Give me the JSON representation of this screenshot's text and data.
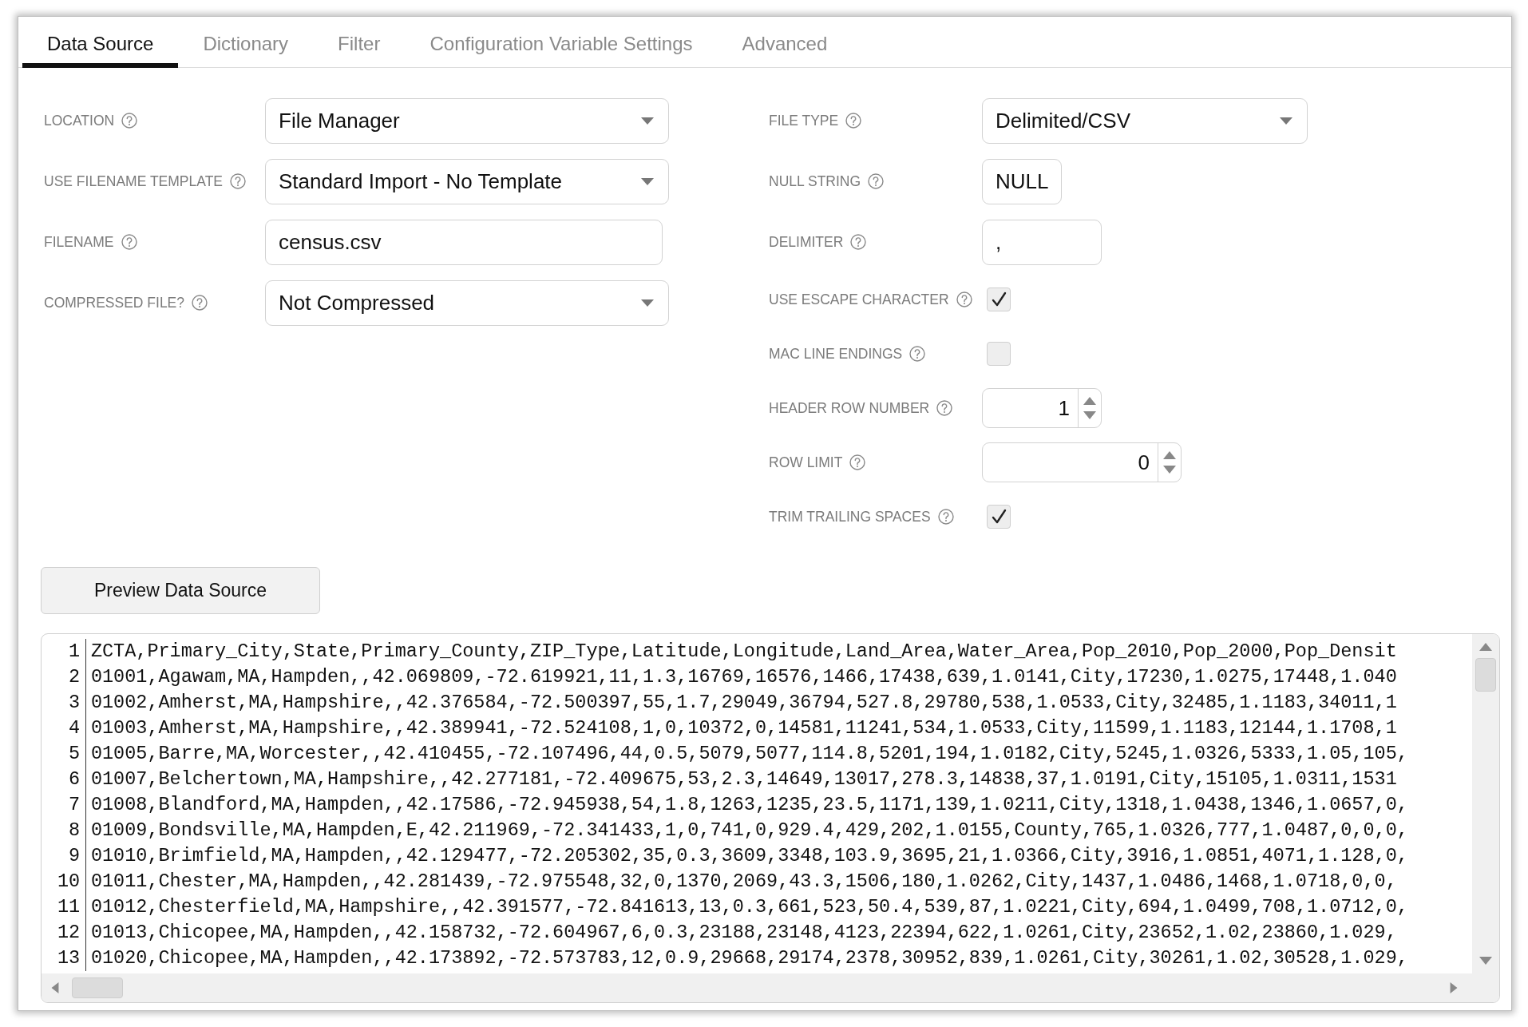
{
  "tabs": [
    {
      "label": "Data Source",
      "selected": true
    },
    {
      "label": "Dictionary",
      "selected": false
    },
    {
      "label": "Filter",
      "selected": false
    },
    {
      "label": "Configuration Variable Settings",
      "selected": false
    },
    {
      "label": "Advanced",
      "selected": false
    }
  ],
  "left_fields": [
    {
      "label": "LOCATION",
      "kind": "dropdown",
      "value": "File Manager"
    },
    {
      "label": "USE FILENAME TEMPLATE",
      "kind": "dropdown",
      "value": "Standard Import - No Template"
    },
    {
      "label": "FILENAME",
      "kind": "text",
      "value": "census.csv"
    },
    {
      "label": "COMPRESSED FILE?",
      "kind": "dropdown",
      "value": "Not Compressed"
    }
  ],
  "right_fields": [
    {
      "label": "FILE TYPE",
      "kind": "dropdown",
      "value": "Delimited/CSV"
    },
    {
      "label": "NULL STRING",
      "kind": "text",
      "value": "NULL"
    },
    {
      "label": "DELIMITER",
      "kind": "text",
      "value": ","
    },
    {
      "label": "USE ESCAPE CHARACTER",
      "kind": "checkbox",
      "checked": true
    },
    {
      "label": "MAC LINE ENDINGS",
      "kind": "checkbox",
      "checked": false
    },
    {
      "label": "HEADER ROW NUMBER",
      "kind": "spinner",
      "value": "1"
    },
    {
      "label": "ROW LIMIT",
      "kind": "spinner",
      "value": "0"
    },
    {
      "label": "TRIM TRAILING SPACES",
      "kind": "checkbox",
      "checked": true
    }
  ],
  "preview_button": "Preview Data Source",
  "preview": {
    "lines": [
      {
        "number": "1",
        "text": "ZCTA,Primary_City,State,Primary_County,ZIP_Type,Latitude,Longitude,Land_Area,Water_Area,Pop_2010,Pop_2000,Pop_Densit"
      },
      {
        "number": "2",
        "text": "01001,Agawam,MA,Hampden,,42.069809,-72.619921,11,1.3,16769,16576,1466,17438,639,1.0141,City,17230,1.0275,17448,1.040"
      },
      {
        "number": "3",
        "text": "01002,Amherst,MA,Hampshire,,42.376584,-72.500397,55,1.7,29049,36794,527.8,29780,538,1.0533,City,32485,1.1183,34011,1"
      },
      {
        "number": "4",
        "text": "01003,Amherst,MA,Hampshire,,42.389941,-72.524108,1,0,10372,0,14581,11241,534,1.0533,City,11599,1.1183,12144,1.1708,1"
      },
      {
        "number": "5",
        "text": "01005,Barre,MA,Worcester,,42.410455,-72.107496,44,0.5,5079,5077,114.8,5201,194,1.0182,City,5245,1.0326,5333,1.05,105,"
      },
      {
        "number": "6",
        "text": "01007,Belchertown,MA,Hampshire,,42.277181,-72.409675,53,2.3,14649,13017,278.3,14838,37,1.0191,City,15105,1.0311,1531"
      },
      {
        "number": "7",
        "text": "01008,Blandford,MA,Hampden,,42.17586,-72.945938,54,1.8,1263,1235,23.5,1171,139,1.0211,City,1318,1.0438,1346,1.0657,0,"
      },
      {
        "number": "8",
        "text": "01009,Bondsville,MA,Hampden,E,42.211969,-72.341433,1,0,741,0,929.4,429,202,1.0155,County,765,1.0326,777,1.0487,0,0,0,"
      },
      {
        "number": "9",
        "text": "01010,Brimfield,MA,Hampden,,42.129477,-72.205302,35,0.3,3609,3348,103.9,3695,21,1.0366,City,3916,1.0851,4071,1.128,0,"
      },
      {
        "number": "10",
        "text": "01011,Chester,MA,Hampden,,42.281439,-72.975548,32,0,1370,2069,43.3,1506,180,1.0262,City,1437,1.0486,1468,1.0718,0,0,"
      },
      {
        "number": "11",
        "text": "01012,Chesterfield,MA,Hampshire,,42.391577,-72.841613,13,0.3,661,523,50.4,539,87,1.0221,City,694,1.0499,708,1.0712,0,"
      },
      {
        "number": "12",
        "text": "01013,Chicopee,MA,Hampden,,42.158732,-72.604967,6,0.3,23188,23148,4123,22394,622,1.0261,City,23652,1.02,23860,1.029,"
      },
      {
        "number": "13",
        "text": "01020,Chicopee,MA,Hampden,,42.173892,-72.573783,12,0.9,29668,29174,2378,30952,839,1.0261,City,30261,1.02,30528,1.029,"
      }
    ]
  }
}
